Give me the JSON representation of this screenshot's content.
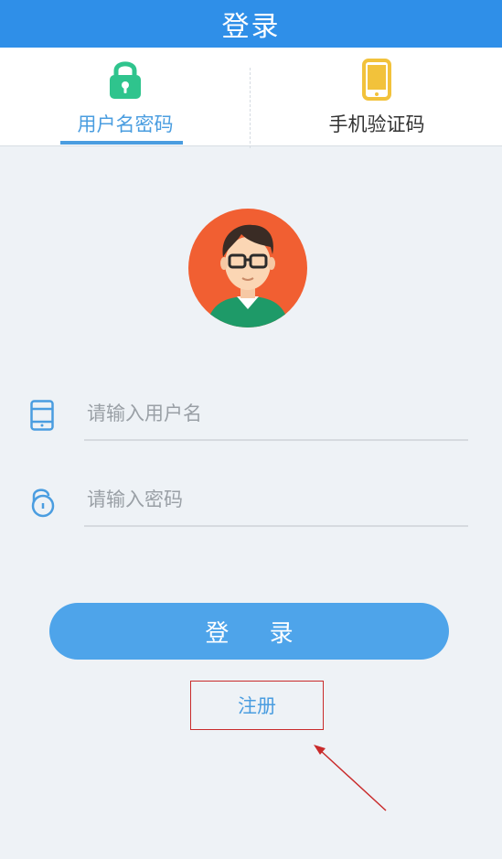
{
  "header": {
    "title": "登录"
  },
  "tabs": [
    {
      "label": "用户名密码",
      "icon": "lock-icon",
      "active": true
    },
    {
      "label": "手机验证码",
      "icon": "phone-icon",
      "active": false
    }
  ],
  "form": {
    "username": {
      "placeholder": "请输入用户名",
      "value": ""
    },
    "password": {
      "placeholder": "请输入密码",
      "value": ""
    }
  },
  "actions": {
    "login_label": "登 录",
    "register_label": "注册"
  },
  "colors": {
    "header": "#2f8fe8",
    "accent": "#4a9de0",
    "button": "#4ea4ea",
    "lock_icon": "#2fc48d",
    "phone_icon": "#f2c23b",
    "annotation": "#c92b2b",
    "background": "#eef2f6"
  },
  "icons": {
    "avatar": "user-avatar",
    "username_field": "tablet-icon",
    "password_field": "unlock-icon"
  }
}
